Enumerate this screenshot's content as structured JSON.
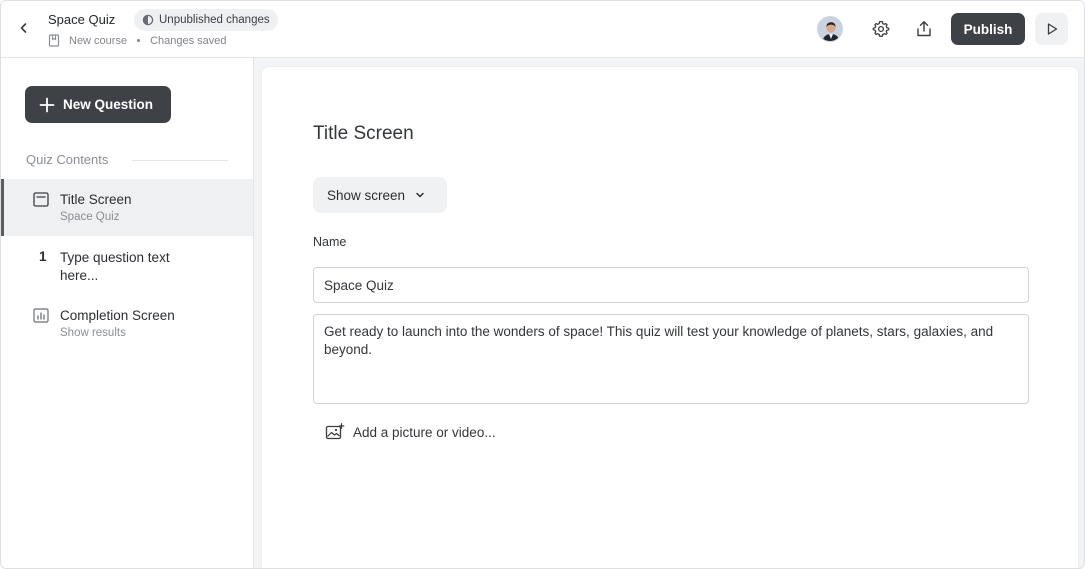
{
  "header": {
    "course_title": "Space Quiz",
    "status_badge": "Unpublished changes",
    "course_type": "New course",
    "save_status": "Changes saved",
    "publish_label": "Publish"
  },
  "icons": {
    "back": "chevron-left-icon",
    "badge": "half-circle-icon",
    "course_type": "bookmark-icon",
    "settings": "gear-icon",
    "share": "upload-icon",
    "preview": "play-icon",
    "add": "plus-icon",
    "title_screen": "window-icon",
    "completion_screen": "bar-chart-icon",
    "dropdown": "chevron-down-icon",
    "media": "image-plus-icon"
  },
  "sidebar": {
    "new_question_label": "New Question",
    "contents_label": "Quiz Contents",
    "items": [
      {
        "title": "Title Screen",
        "subtitle": "Space Quiz",
        "active": true
      },
      {
        "number": "1",
        "title_line1": "Type question text",
        "title_line2": "here...",
        "active": false
      },
      {
        "title": "Completion Screen",
        "subtitle": "Show results",
        "active": false
      }
    ]
  },
  "main": {
    "screen_title": "Title Screen",
    "show_screen_label": "Show screen",
    "name_label": "Name",
    "name_value": "Space Quiz",
    "description_value": "Get ready to launch into the wonders of space! This quiz will test your knowledge of planets, stars, galaxies, and beyond.",
    "add_media_label": "Add a picture or video..."
  },
  "colors": {
    "primary_button": "#3e4246",
    "active_item_bg": "#eef0f2",
    "main_background": "#f3f4f6"
  }
}
